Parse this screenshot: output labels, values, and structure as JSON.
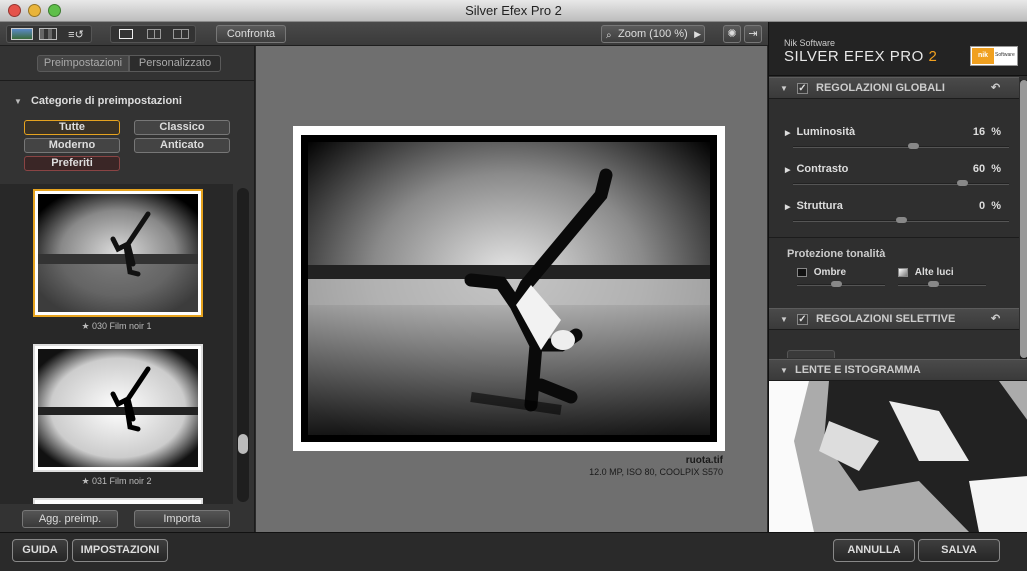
{
  "window": {
    "title": "Silver Efex Pro 2"
  },
  "toolbar": {
    "compare_label": "Confronta",
    "zoom_label": "Zoom (100 %)"
  },
  "left_panel": {
    "tabs": [
      "Preimpostazioni",
      "Personalizzato"
    ],
    "category_header": "Categorie di preimpostazioni",
    "categories": [
      "Tutte",
      "Classico",
      "Moderno",
      "Anticato",
      "Preferiti"
    ],
    "thumbnails": [
      {
        "label": "030 Film noir 1"
      },
      {
        "label": "031 Film noir 2"
      }
    ],
    "add_preset_label": "Agg. preimp.",
    "import_label": "Importa"
  },
  "image": {
    "filename": "ruota.tif",
    "info": "12.0 MP, ISO 80, COOLPIX S570"
  },
  "right_panel": {
    "brand_company": "Nik Software",
    "brand_product": "SILVER EFEX PRO",
    "brand_version": "2",
    "logo_text": "nik",
    "logo_sub": "Software",
    "global_header": "REGOLAZIONI GLOBALI",
    "sliders": [
      {
        "label": "Luminosità",
        "value": "16",
        "unit": "%",
        "level": 0.56
      },
      {
        "label": "Contrasto",
        "value": "60",
        "unit": "%",
        "level": 0.8
      },
      {
        "label": "Struttura",
        "value": "0",
        "unit": "%",
        "level": 0.5
      }
    ],
    "tonal_header": "Protezione tonalità",
    "shadows_label": "Ombre",
    "highlights_label": "Alte luci",
    "selective_header": "REGOLAZIONI SELETTIVE",
    "loupe_header": "LENTE E ISTOGRAMMA"
  },
  "bottom_bar": {
    "help_label": "GUIDA",
    "settings_label": "IMPOSTAZIONI",
    "cancel_label": "ANNULLA",
    "save_label": "SALVA"
  },
  "colors": {
    "accent": "#e6a31f",
    "brand_version": "#f0a020"
  }
}
